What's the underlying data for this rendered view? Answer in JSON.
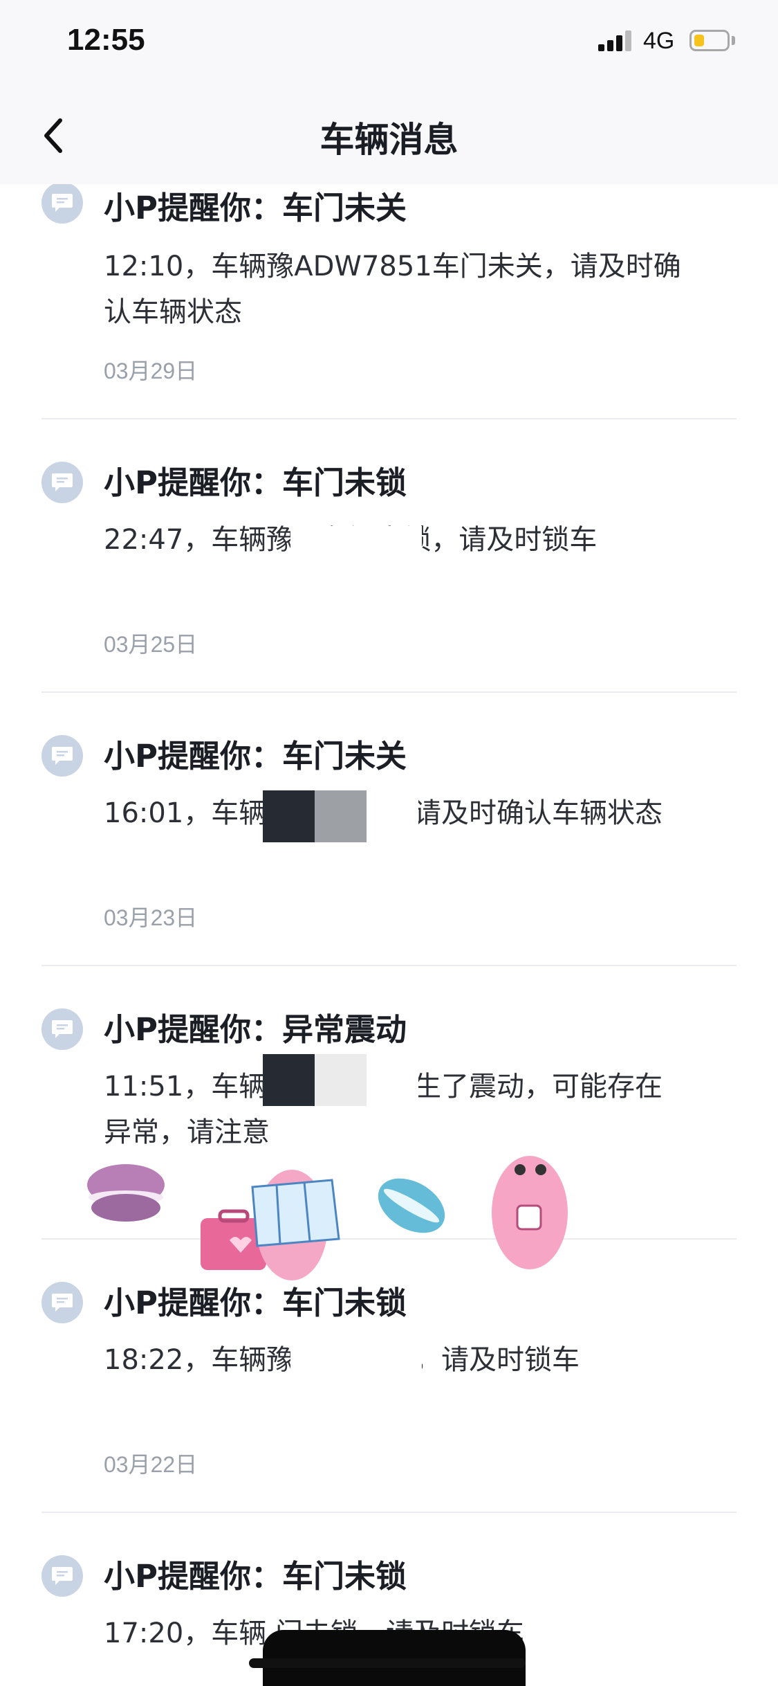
{
  "status_bar": {
    "time": "12:55",
    "network": "4G",
    "signal_icon": "signal-icon",
    "battery_icon": "battery-low-icon"
  },
  "nav": {
    "title": "车辆消息",
    "back_icon": "chevron-left-icon"
  },
  "messages": [
    {
      "title": "小P提醒你：车门未关",
      "body": "12:10，车辆豫ADW7851车门未关，请及时确认车辆状态",
      "date": "03月29日"
    },
    {
      "title": "小P提醒你：车门未锁",
      "body": "22:47，车辆豫 1车门未锁，请及时锁车",
      "date": "03月25日"
    },
    {
      "title": "小P提醒你：车门未关",
      "body": "16:01，车辆 车门未关，请及时确认车辆状态",
      "date": "03月23日"
    },
    {
      "title": "小P提醒你：异常震动",
      "body": "11:51，车辆 由于外力产生了震动，可能存在异常，请注意",
      "date": ""
    },
    {
      "title": "小P提醒你：车门未锁",
      "body": "18:22，车辆豫 车门未锁，请及时锁车",
      "date": "03月22日"
    },
    {
      "title": "小P提醒你：车门未锁",
      "body": "17:20，车辆 门未锁，请及时锁车",
      "date": ""
    }
  ],
  "colors": {
    "icon_bg": "#c8d3e4",
    "divider": "#ececf0",
    "date": "#9aa0aa",
    "battery": "#f6c21c"
  }
}
